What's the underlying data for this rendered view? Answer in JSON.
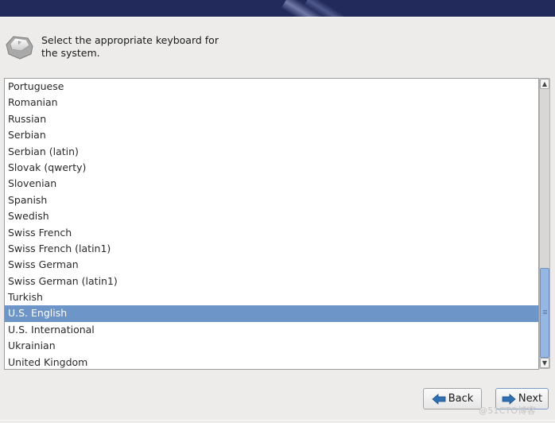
{
  "header": {
    "prompt": "Select the appropriate keyboard for the system.",
    "icon": "keyboard-key-icon"
  },
  "keyboard_list": {
    "items": [
      "Portuguese",
      "Romanian",
      "Russian",
      "Serbian",
      "Serbian (latin)",
      "Slovak (qwerty)",
      "Slovenian",
      "Spanish",
      "Swedish",
      "Swiss French",
      "Swiss French (latin1)",
      "Swiss German",
      "Swiss German (latin1)",
      "Turkish",
      "U.S. English",
      "U.S. International",
      "Ukrainian",
      "United Kingdom"
    ],
    "selected": "U.S. English",
    "selection_color": "#6d95c8"
  },
  "scrollbar": {
    "up_icon": "chevron-up-icon",
    "down_icon": "chevron-down-icon",
    "position": "near-bottom"
  },
  "buttons": {
    "back_label": "Back",
    "next_label": "Next",
    "back_icon": "arrow-left-icon",
    "next_icon": "arrow-right-icon"
  },
  "watermark": "@51CTO博客",
  "colors": {
    "banner": "#222a5c",
    "background": "#edeceb",
    "arrow_blue": "#2f6fb3"
  }
}
